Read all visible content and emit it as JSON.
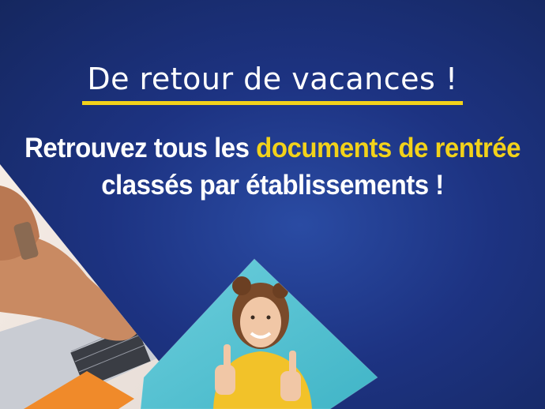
{
  "headline": "De retour de vacances !",
  "subline": {
    "part1": "Retrouvez tous les ",
    "highlight": "documents de rentrée",
    "line2": "classés par établissements !"
  },
  "colors": {
    "background": "#1d3382",
    "accent": "#f2d21a",
    "text": "#ffffff"
  },
  "images": [
    "laptop-typing-photo",
    "thumbs-up-woman-photo"
  ]
}
